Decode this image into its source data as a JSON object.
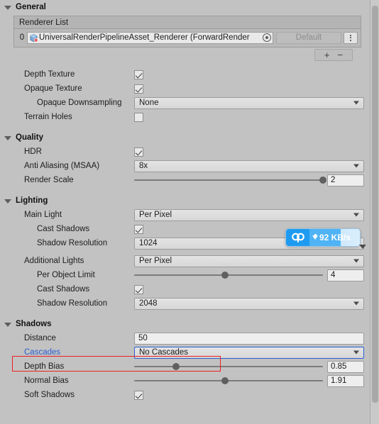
{
  "window": {
    "title": "Universal Render Pipeline Asset Inspector",
    "background_color": "#c2c2c2",
    "accent_blue": "#2b5fd0",
    "annotation_color": "#ef1f1f"
  },
  "sections": {
    "general": {
      "title": "General",
      "renderer_list": {
        "header": "Renderer List",
        "items": [
          {
            "index": "0",
            "name": "UniversalRenderPipelineAsset_Renderer (ForwardRender",
            "icon": "scriptable-object-icon",
            "picker_icon": "object-picker-icon",
            "default_label": "Default",
            "menu_icon": "kebab-menu-icon"
          }
        ],
        "add_label": "+",
        "remove_label": "−"
      },
      "rows": [
        {
          "label": "Depth Texture",
          "type": "checkbox",
          "value": true
        },
        {
          "label": "Opaque Texture",
          "type": "checkbox",
          "value": true
        },
        {
          "label": "Opaque Downsampling",
          "type": "dropdown",
          "value": "None",
          "indent": 2
        },
        {
          "label": "Terrain Holes",
          "type": "checkbox",
          "value": false
        }
      ]
    },
    "quality": {
      "title": "Quality",
      "rows": [
        {
          "label": "HDR",
          "type": "checkbox",
          "value": true
        },
        {
          "label": "Anti Aliasing (MSAA)",
          "type": "dropdown",
          "value": "8x"
        },
        {
          "label": "Render Scale",
          "type": "slider",
          "value": "2",
          "percent": 100
        }
      ]
    },
    "lighting": {
      "title": "Lighting",
      "rows": [
        {
          "label": "Main Light",
          "type": "dropdown",
          "value": "Per Pixel"
        },
        {
          "label": "Cast Shadows",
          "type": "checkbox",
          "value": true,
          "indent": 2
        },
        {
          "label": "Shadow Resolution",
          "type": "dropdown",
          "value": "1024",
          "indent": 2
        },
        {
          "label": "Additional Lights",
          "type": "dropdown",
          "value": "Per Pixel"
        },
        {
          "label": "Per Object Limit",
          "type": "slider",
          "value": "4",
          "percent": 48,
          "indent": 2
        },
        {
          "label": "Cast Shadows",
          "type": "checkbox",
          "value": true,
          "indent": 2
        },
        {
          "label": "Shadow Resolution",
          "type": "dropdown",
          "value": "2048",
          "indent": 2
        }
      ]
    },
    "shadows": {
      "title": "Shadows",
      "rows": [
        {
          "label": "Distance",
          "type": "text",
          "value": "50"
        },
        {
          "label": "Cascades",
          "type": "dropdown",
          "value": "No Cascades",
          "highlighted": true,
          "focused": true
        },
        {
          "label": "Depth Bias",
          "type": "slider",
          "value": "0.85",
          "percent": 22
        },
        {
          "label": "Normal Bias",
          "type": "slider",
          "value": "1.91",
          "percent": 48
        },
        {
          "label": "Soft Shadows",
          "type": "checkbox",
          "value": true
        }
      ]
    }
  },
  "download_toast": {
    "icon": "cloud-disk-icon",
    "direction_icon": "download-arrow-icon",
    "speed_text": "92 KB/s",
    "progress_percent": 62,
    "icon_bg": "#1e9bf0",
    "bar_color": "#4fb3f5"
  },
  "scrollbar": {
    "name": "vertical-scrollbar"
  }
}
